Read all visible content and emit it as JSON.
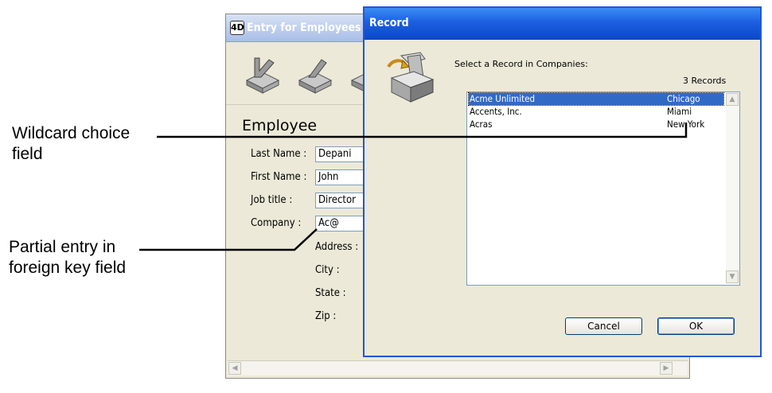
{
  "entry_window": {
    "title": "Entry for Employees",
    "app_icon": "4D",
    "toolbar_icons": [
      "first-record-icon",
      "previous-record-icon",
      "next-record-icon"
    ],
    "form_heading": "Employee",
    "fields": {
      "last_name": {
        "label": "Last Name :",
        "value": "Depani"
      },
      "first_name": {
        "label": "First Name :",
        "value": "John"
      },
      "job_title": {
        "label": "Job title :",
        "value": "Director"
      },
      "company": {
        "label": "Company :",
        "value": "Ac@"
      },
      "address": {
        "label": "Address :"
      },
      "city": {
        "label": "City :"
      },
      "state": {
        "label": "State :"
      },
      "zip": {
        "label": "Zip :"
      }
    }
  },
  "record_dialog": {
    "title": "Record",
    "prompt": "Select a Record in Companies:",
    "records_count": "3 Records",
    "rows": [
      {
        "name": "Acme Unlimited",
        "city": "Chicago",
        "selected": true
      },
      {
        "name": "Accents, Inc.",
        "city": "Miami",
        "selected": false
      },
      {
        "name": "Acras",
        "city": "New York",
        "selected": false
      }
    ],
    "cancel_label": "Cancel",
    "ok_label": "OK"
  },
  "annotations": {
    "wildcard_line1": "Wildcard choice",
    "wildcard_line2": "field",
    "partial_line1": "Partial entry in",
    "partial_line2": "foreign key field"
  },
  "colors": {
    "dialog_title_blue": "#0a47c8",
    "selection_blue": "#316ac5",
    "window_face": "#ece9d8"
  }
}
